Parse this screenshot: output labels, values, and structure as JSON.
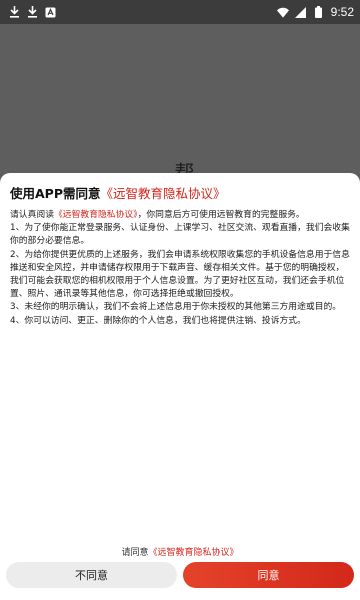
{
  "status_bar": {
    "time": "9:52",
    "left_icons": [
      "download-icon",
      "download-icon",
      "app-notification-icon"
    ],
    "right_icons": [
      "wifi-icon",
      "signal-icon",
      "battery-icon"
    ]
  },
  "background_page": {
    "title_fragment": "帮助"
  },
  "dialog": {
    "title_prefix": "使用APP需同意",
    "title_link": "《远智教育隐私协议》",
    "intro_prefix": "请认真阅读",
    "intro_link": "《远智教育隐私协议》",
    "intro_suffix": "，你同意后方可使用远智教育的完整服务。",
    "paragraphs": [
      "1、为了使你能正常登录服务、认证身份、上课学习、社区交流、观看直播，我们会收集你的部分必要信息。",
      "2、为给你提供更优质的上述服务，我们会申请系统权限收集您的手机设备信息用于信息推送和安全风控，并申请储存权限用于下载声音、缓存相关文件。基于您的明确授权，我们可能会获取您的相机权限用于个人信息设置。为了更好社区互动，我们还会手机位置、照片、通讯录等其他信息，你可选择拒绝或撤回授权。",
      "3、未经你的明示确认，我们不会将上述信息用于你未授权的其他第三方用途或目的。",
      "4、你可以访问、更正、删除你的个人信息，我们也将提供注销、投诉方式。"
    ],
    "agree_hint_prefix": "请同意",
    "agree_hint_link": "《远智教育隐私协议》",
    "decline_label": "不同意",
    "accept_label": "同意"
  },
  "colors": {
    "accent": "#d6261b",
    "overlay": "#5e5e5e",
    "status_bar": "#3c3c3c"
  }
}
